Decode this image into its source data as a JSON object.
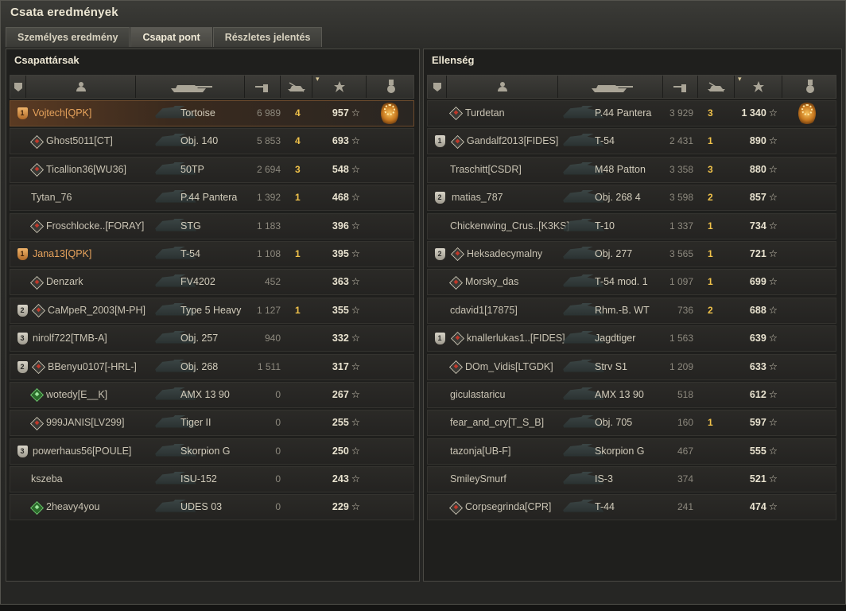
{
  "window": {
    "title": "Csata eredmények"
  },
  "tabs": [
    {
      "label": "Személyes eredmény",
      "active": false
    },
    {
      "label": "Csapat pont",
      "active": true
    },
    {
      "label": "Részletes jelentés",
      "active": false
    }
  ],
  "teams": {
    "left": {
      "title": "Csapattársak",
      "rows": [
        {
          "badge": "1",
          "badge_style": "gold",
          "mark": "",
          "name": "Vojtech[QPK]",
          "tank": "Tortoise",
          "damage": "6 989",
          "kills": "4",
          "xp": "957",
          "medal": true,
          "highlight": true,
          "gold_text": true
        },
        {
          "badge": "",
          "badge_style": "",
          "mark": "mastery-2",
          "name": "Ghost5011[CT]",
          "tank": "Obj. 140",
          "damage": "5 853",
          "kills": "4",
          "xp": "693",
          "medal": false
        },
        {
          "badge": "",
          "badge_style": "",
          "mark": "mark",
          "name": "Ticallion36[WU36]",
          "tank": "50TP",
          "damage": "2 694",
          "kills": "3",
          "xp": "548",
          "medal": false
        },
        {
          "badge": "",
          "badge_style": "",
          "mark": "",
          "name": "Tytan_76",
          "tank": "P.44 Pantera",
          "damage": "1 392",
          "kills": "1",
          "xp": "468",
          "medal": false
        },
        {
          "badge": "",
          "badge_style": "",
          "mark": "mark",
          "name": "Froschlocke..[FORAY]",
          "tank": "STG",
          "damage": "1 183",
          "kills": "",
          "xp": "396",
          "medal": false
        },
        {
          "badge": "1",
          "badge_style": "gold",
          "mark": "",
          "name": "Jana13[QPK]",
          "tank": "T-54",
          "damage": "1 108",
          "kills": "1",
          "xp": "395",
          "medal": false,
          "gold_text": true
        },
        {
          "badge": "",
          "badge_style": "",
          "mark": "mark",
          "name": "Denzark",
          "tank": "FV4202",
          "damage": "452",
          "kills": "",
          "xp": "363",
          "medal": false
        },
        {
          "badge": "2",
          "badge_style": "",
          "mark": "mark",
          "name": "CaMpeR_2003[M-PH]",
          "tank": "Type 5 Heavy",
          "damage": "1 127",
          "kills": "1",
          "xp": "355",
          "medal": false
        },
        {
          "badge": "3",
          "badge_style": "",
          "mark": "",
          "name": "nirolf722[TMB-A]",
          "tank": "Obj. 257",
          "damage": "940",
          "kills": "",
          "xp": "332",
          "medal": false
        },
        {
          "badge": "2",
          "badge_style": "",
          "mark": "mark",
          "name": "BBenyu0107[-HRL-]",
          "tank": "Obj. 268",
          "damage": "1 511",
          "kills": "",
          "xp": "317",
          "medal": false
        },
        {
          "badge": "",
          "badge_style": "",
          "mark": "green",
          "name": "wotedy[E__K]",
          "tank": "AMX 13 90",
          "damage": "0",
          "kills": "",
          "xp": "267",
          "medal": false
        },
        {
          "badge": "",
          "badge_style": "",
          "mark": "mark",
          "name": "999JANIS[LV299]",
          "tank": "Tiger II",
          "damage": "0",
          "kills": "",
          "xp": "255",
          "medal": false
        },
        {
          "badge": "3",
          "badge_style": "",
          "mark": "",
          "name": "powerhaus56[POULE]",
          "tank": "Skorpion G",
          "damage": "0",
          "kills": "",
          "xp": "250",
          "medal": false
        },
        {
          "badge": "",
          "badge_style": "",
          "mark": "",
          "name": "kszeba",
          "tank": "ISU-152",
          "damage": "0",
          "kills": "",
          "xp": "243",
          "medal": false
        },
        {
          "badge": "",
          "badge_style": "",
          "mark": "green",
          "name": "2heavy4you",
          "tank": "UDES 03",
          "damage": "0",
          "kills": "",
          "xp": "229",
          "medal": false
        }
      ]
    },
    "right": {
      "title": "Ellenség",
      "rows": [
        {
          "badge": "",
          "badge_style": "",
          "mark": "mark",
          "name": "Turdetan",
          "tank": "P.44 Pantera",
          "damage": "3 929",
          "kills": "3",
          "xp": "1 340",
          "medal": true
        },
        {
          "badge": "1",
          "badge_style": "",
          "mark": "mastery",
          "name": "Gandalf2013[FIDES]",
          "tank": "T-54",
          "damage": "2 431",
          "kills": "1",
          "xp": "890",
          "medal": false
        },
        {
          "badge": "",
          "badge_style": "",
          "mark": "",
          "name": "Traschitt[CSDR]",
          "tank": "M48 Patton",
          "damage": "3 358",
          "kills": "3",
          "xp": "880",
          "medal": false
        },
        {
          "badge": "2",
          "badge_style": "",
          "mark": "",
          "name": "matias_787",
          "tank": "Obj. 268 4",
          "damage": "3 598",
          "kills": "2",
          "xp": "857",
          "medal": false
        },
        {
          "badge": "",
          "badge_style": "",
          "mark": "",
          "name": "Chickenwing_Crus..[K3KS]",
          "tank": "T-10",
          "damage": "1 337",
          "kills": "1",
          "xp": "734",
          "medal": false
        },
        {
          "badge": "2",
          "badge_style": "",
          "mark": "mastery-1",
          "name": "Heksadecymalny",
          "tank": "Obj. 277",
          "damage": "3 565",
          "kills": "1",
          "xp": "721",
          "medal": false
        },
        {
          "badge": "",
          "badge_style": "",
          "mark": "mark",
          "name": "Morsky_das",
          "tank": "T-54 mod. 1",
          "damage": "1 097",
          "kills": "1",
          "xp": "699",
          "medal": false
        },
        {
          "badge": "",
          "badge_style": "",
          "mark": "",
          "name": "cdavid1[17875]",
          "tank": "Rhm.-B. WT",
          "damage": "736",
          "kills": "2",
          "xp": "688",
          "medal": false
        },
        {
          "badge": "1",
          "badge_style": "",
          "mark": "mark",
          "name": "knallerlukas1..[FIDES]",
          "tank": "Jagdtiger",
          "damage": "1 563",
          "kills": "",
          "xp": "639",
          "medal": false
        },
        {
          "badge": "",
          "badge_style": "",
          "mark": "mastery",
          "name": "DOm_Vidis[LTGDK]",
          "tank": "Strv S1",
          "damage": "1 209",
          "kills": "",
          "xp": "633",
          "medal": false
        },
        {
          "badge": "",
          "badge_style": "",
          "mark": "",
          "name": "giculastaricu",
          "tank": "AMX 13 90",
          "damage": "518",
          "kills": "",
          "xp": "612",
          "medal": false
        },
        {
          "badge": "",
          "badge_style": "",
          "mark": "",
          "name": "fear_and_cry[T_S_B]",
          "tank": "Obj. 705",
          "damage": "160",
          "kills": "1",
          "xp": "597",
          "medal": false
        },
        {
          "badge": "",
          "badge_style": "",
          "mark": "",
          "name": "tazonja[UB-F]",
          "tank": "Skorpion G",
          "damage": "467",
          "kills": "",
          "xp": "555",
          "medal": false
        },
        {
          "badge": "",
          "badge_style": "",
          "mark": "",
          "name": "SmileySmurf",
          "tank": "IS-3",
          "damage": "374",
          "kills": "",
          "xp": "521",
          "medal": false
        },
        {
          "badge": "",
          "badge_style": "",
          "mark": "mark",
          "name": "Corpsegrinda[CPR]",
          "tank": "T-44",
          "damage": "241",
          "kills": "",
          "xp": "474",
          "medal": false
        }
      ]
    }
  },
  "columns": {
    "icons": [
      "platoon-icon",
      "player-icon",
      "tank-icon",
      "damage-icon",
      "kills-icon",
      "xp-star-icon",
      "medal-icon"
    ],
    "xp_suffix": "☆"
  },
  "colors": {
    "gold_text": "#e7a35c",
    "kills": "#f0c24a",
    "highlight": "#5a3a22"
  }
}
